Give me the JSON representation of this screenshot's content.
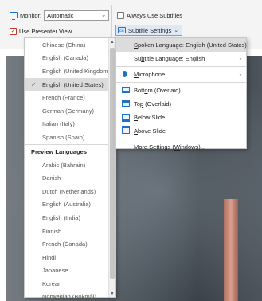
{
  "ribbon": {
    "monitor_label": "Monitor:",
    "monitor_value": "Automatic",
    "presenter_view_label": "Use Presenter View",
    "always_subtitles_label": "Always Use Subtitles",
    "subtitle_settings_label": "Subtitle Settings"
  },
  "languages": {
    "items": [
      "Chinese (China)",
      "English (Canada)",
      "English (United Kingdom)",
      "English (United States)",
      "French (France)",
      "German (Germany)",
      "Italian (Italy)",
      "Spanish (Spain)"
    ],
    "selected": "English (United States)",
    "preview_header": "Preview Languages",
    "preview_items": [
      "Arabic (Bahrain)",
      "Danish",
      "Dutch (Netherlands)",
      "English (Australia)",
      "English (India)",
      "Finnish",
      "French (Canada)",
      "Hindi",
      "Japanese",
      "Korean",
      "Norwegian (Bokmål)"
    ]
  },
  "menu": {
    "spoken_prefix": "S",
    "spoken_rest": "poken Language: English (United States)",
    "subtitle_pre": "Su",
    "subtitle_ul": "b",
    "subtitle_rest": "title Language: English",
    "mic_ul": "M",
    "mic_rest": "icrophone",
    "bottom_pre": "Bott",
    "bottom_ul": "o",
    "bottom_rest": "m (Overlaid)",
    "top_pre": "To",
    "top_ul": "p",
    "top_rest": " (Overlaid)",
    "below_ul": "B",
    "below_rest": "elow Slide",
    "above_ul": "A",
    "above_rest": "bove Slide",
    "more_pre": "More Settings (",
    "more_ul": "W",
    "more_rest": "indows)..."
  }
}
